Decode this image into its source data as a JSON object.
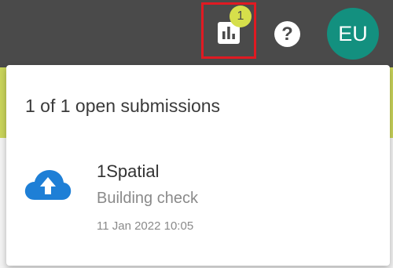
{
  "header": {
    "reports_icon": "bar-chart-icon",
    "notification_count": "1",
    "help_icon": "question-mark-icon",
    "help_glyph": "?",
    "avatar_initials": "EU",
    "colors": {
      "topbar": "#4a4a4a",
      "highlight_border": "#e01a22",
      "badge": "#d6df4b",
      "avatar": "#13907f",
      "accent": "#c8d35a"
    }
  },
  "panel": {
    "title": "1 of 1 open submissions",
    "items": [
      {
        "icon": "cloud-upload-icon",
        "icon_color": "#1e7fd6",
        "name": "1Spatial",
        "description": "Building check",
        "timestamp": "11 Jan 2022 10:05"
      }
    ]
  }
}
